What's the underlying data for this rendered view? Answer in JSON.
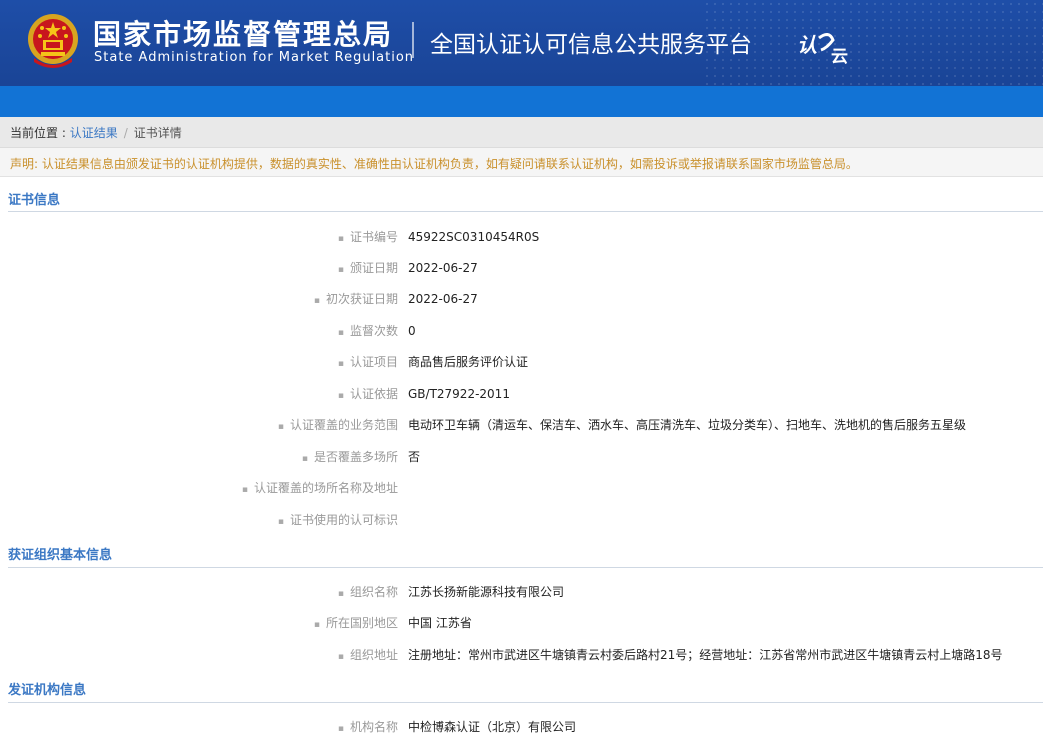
{
  "header": {
    "org_cn": "国家市场监督管理总局",
    "org_en": "State Administration for Market Regulation",
    "platform": "全国认证认可信息公共服务平台",
    "logo_text": "认云",
    "emblem_icon": "national-emblem-icon",
    "bg_color": "#1e4ea8"
  },
  "breadcrumb": {
    "prefix": "当前位置 : ",
    "link": "认证结果",
    "separator": "/",
    "current": "证书详情"
  },
  "notice": "声明: 认证结果信息由颁发证书的认证机构提供，数据的真实性、准确性由认证机构负责，如有疑问请联系认证机构，如需投诉或举报请联系国家市场监管总局。",
  "sections": {
    "cert": {
      "title": "证书信息",
      "rows": [
        {
          "label": "证书编号",
          "value": "45922SC0310454R0S"
        },
        {
          "label": "颁证日期",
          "value": "2022-06-27"
        },
        {
          "label": "初次获证日期",
          "value": "2022-06-27"
        },
        {
          "label": "监督次数",
          "value": "0"
        },
        {
          "label": "认证项目",
          "value": "商品售后服务评价认证"
        },
        {
          "label": "认证依据",
          "value": "GB/T27922-2011"
        },
        {
          "label": "认证覆盖的业务范围",
          "value": "电动环卫车辆（清运车、保洁车、洒水车、高压清洗车、垃圾分类车）、扫地车、洗地机的售后服务五星级"
        },
        {
          "label": "是否覆盖多场所",
          "value": "否"
        },
        {
          "label": "认证覆盖的场所名称及地址",
          "value": ""
        },
        {
          "label": "证书使用的认可标识",
          "value": ""
        }
      ]
    },
    "org": {
      "title": "获证组织基本信息",
      "rows": [
        {
          "label": "组织名称",
          "value": "江苏长扬新能源科技有限公司"
        },
        {
          "label": "所在国别地区",
          "value": "中国 江苏省"
        },
        {
          "label": "组织地址",
          "value": "注册地址：常州市武进区牛塘镇青云村委后路村21号；经营地址：江苏省常州市武进区牛塘镇青云村上塘路18号"
        }
      ]
    },
    "issuer": {
      "title": "发证机构信息",
      "rows": [
        {
          "label": "机构名称",
          "value": "中检博森认证（北京）有限公司"
        }
      ]
    }
  },
  "colors": {
    "link": "#3b78c4",
    "notice": "#c9902b",
    "navbar": "#1273d5"
  }
}
